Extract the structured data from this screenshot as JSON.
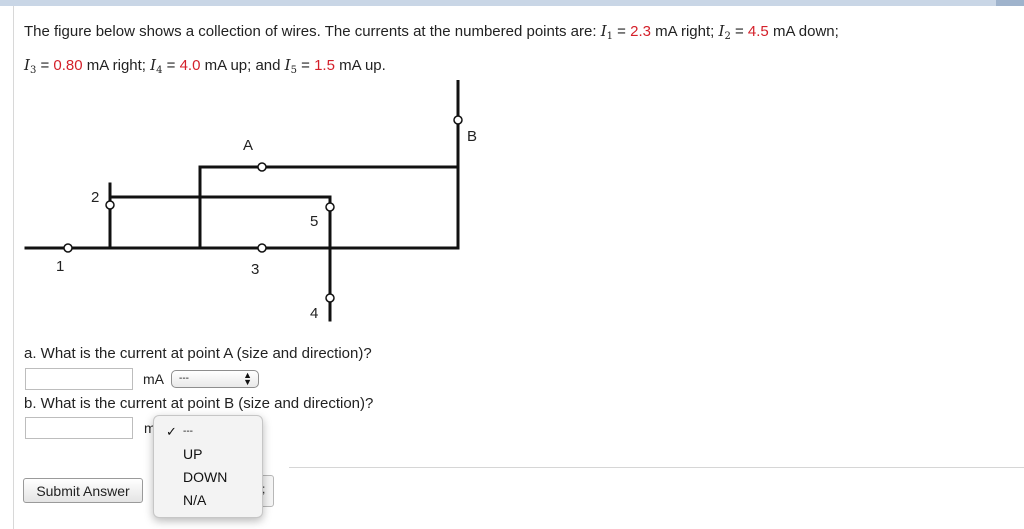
{
  "problem": {
    "line1_prefix": "The figure below shows a collection of wires. The currents at the numbered points are: ",
    "i1_symbol": "I",
    "i1_sub": "1",
    "i1_eq": " = ",
    "i1_value": "2.3",
    "i1_dir": " mA right; ",
    "i2_symbol": "I",
    "i2_sub": "2",
    "i2_eq": " = ",
    "i2_value": "4.5",
    "i2_dir": " mA down;",
    "i3_symbol": "I",
    "i3_sub": "3",
    "i3_eq": " = ",
    "i3_value": "0.80",
    "i3_dir": " mA right; ",
    "i4_symbol": "I",
    "i4_sub": "4",
    "i4_eq": " = ",
    "i4_value": "4.0",
    "i4_dir": " mA up; and ",
    "i5_symbol": "I",
    "i5_sub": "5",
    "i5_eq": " = ",
    "i5_value": "1.5",
    "i5_dir": " mA up.",
    "value_color": "#d4202a"
  },
  "figure": {
    "label_a": "A",
    "label_b": "B",
    "label_1": "1",
    "label_2": "2",
    "label_3": "3",
    "label_4": "4",
    "label_5": "5"
  },
  "question_a": {
    "text": "a. What is the current at point A (size and direction)?",
    "input_value": "",
    "unit": "mA",
    "direction_selected": "---"
  },
  "question_b": {
    "text": "b. What is the current at point B (size and direction)?",
    "input_value": "",
    "unit_partial": "m"
  },
  "dropdown": {
    "check_mark": "✓",
    "options": [
      "---",
      "UP",
      "DOWN",
      "N/A"
    ],
    "selected_index": 0
  },
  "submit_label": "Submit Answer"
}
